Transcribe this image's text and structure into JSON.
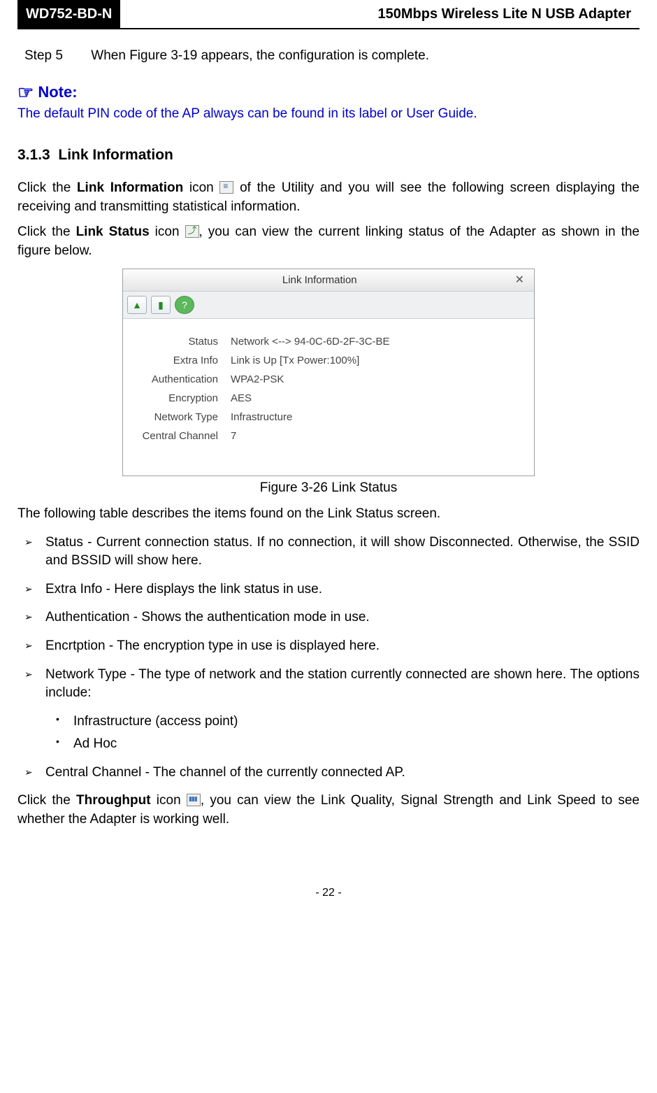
{
  "header": {
    "model": "WD752-BD-N",
    "title": "150Mbps Wireless Lite N USB Adapter"
  },
  "step": {
    "label": "Step 5",
    "text": "When Figure 3-19 appears, the configuration is complete."
  },
  "note": {
    "title": "Note:",
    "body": "The default PIN code of the AP always can be found in its label or User Guide."
  },
  "section": {
    "num": "3.1.3",
    "title": "Link Information"
  },
  "p1": {
    "prefix": "Click the ",
    "bold1": "Link Information",
    "mid1": " icon ",
    "after1": " of the Utility and you will see the following screen displaying the receiving and transmitting statistical information."
  },
  "p2": {
    "prefix": "Click the ",
    "bold1": "Link Status",
    "mid1": " icon ",
    "after1": ", you can view the current linking status of the Adapter as shown in the figure below."
  },
  "dialog": {
    "title": "Link Information",
    "rows": {
      "status_l": "Status",
      "status_v": "Network <--> 94-0C-6D-2F-3C-BE",
      "extra_l": "Extra Info",
      "extra_v": "Link is Up  [Tx Power:100%]",
      "auth_l": "Authentication",
      "auth_v": "WPA2-PSK",
      "enc_l": "Encryption",
      "enc_v": "AES",
      "net_l": "Network Type",
      "net_v": "Infrastructure",
      "chan_l": "Central Channel",
      "chan_v": "7"
    }
  },
  "fig_caption": "Figure 3-26 Link Status",
  "table_intro": "The following table describes the items found on the Link Status screen.",
  "bullets": {
    "b1t": "Status - ",
    "b1b": "Current connection status. If no connection, it will show Disconnected. Otherwise, the SSID and BSSID will show here.",
    "b2t": "Extra Info - ",
    "b2b": "Here displays the link status in use.",
    "b3t": "Authentication - ",
    "b3b": "Shows the authentication mode in use.",
    "b4t": "Encrtption - ",
    "b4b": "The encryption type in use is displayed here.",
    "b5t": "Network Type - ",
    "b5b": "The type of network and the station currently connected are shown here. The options include:",
    "s1": "Infrastructure (access point)",
    "s2": "Ad Hoc",
    "b6t": "Central Channel - ",
    "b6b": "The channel of the currently connected AP."
  },
  "p3": {
    "prefix": "Click the ",
    "bold1": "Throughput",
    "mid1": " icon ",
    "after1": ", you can view the Link Quality, Signal Strength and Link Speed to see whether the Adapter is working well."
  },
  "page_num": "- 22 -"
}
